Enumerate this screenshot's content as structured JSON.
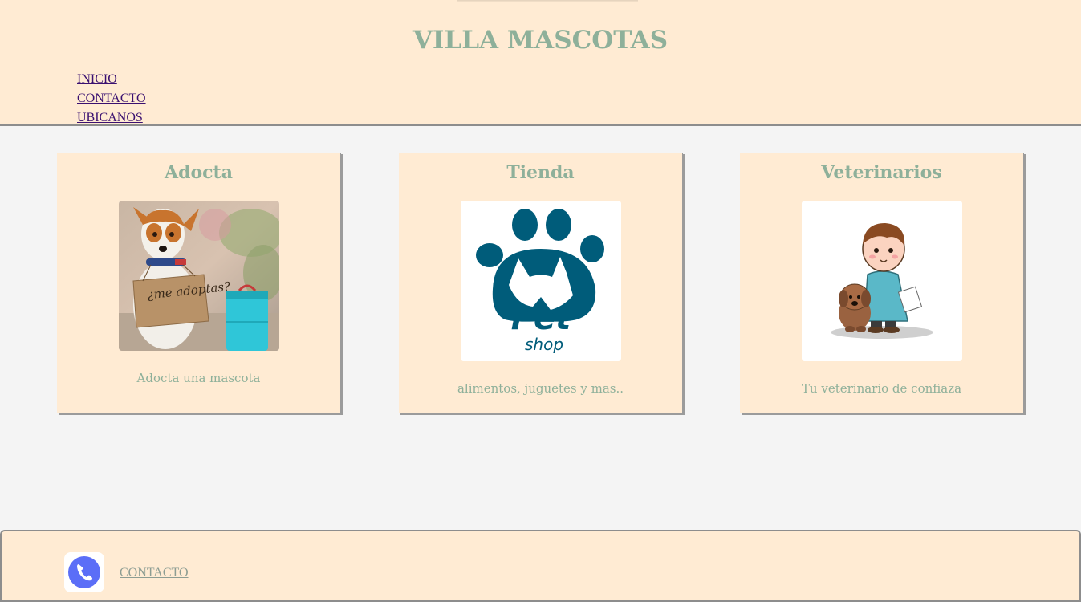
{
  "header": {
    "title": "VILLA MASCOTAS",
    "nav": [
      "INICIO",
      "CONTACTO",
      "UBICANOS"
    ]
  },
  "cards": [
    {
      "title": "Adocta",
      "caption": "Adocta una mascota",
      "sign_text": "¿me adoptas?",
      "image": "dog-with-adopt-sign"
    },
    {
      "title": "Tienda",
      "caption": "alimentos, juguetes y mas..",
      "logo_line1": "Pet",
      "logo_line2": "shop",
      "image": "pet-shop-paw-logo"
    },
    {
      "title": "Veterinarios",
      "caption": "Tu veterinario de confiaza",
      "image": "vet-cartoon-with-dog"
    }
  ],
  "footer": {
    "contact_label": "CONTACTO",
    "icon": "phone-icon"
  },
  "colors": {
    "panel": "#ffebd3",
    "background": "#f4f4f4",
    "title_green": "#8eb09a",
    "link_purple": "#3a1070",
    "logo_teal": "#005c7a",
    "phone_blue": "#5b6ef7"
  }
}
